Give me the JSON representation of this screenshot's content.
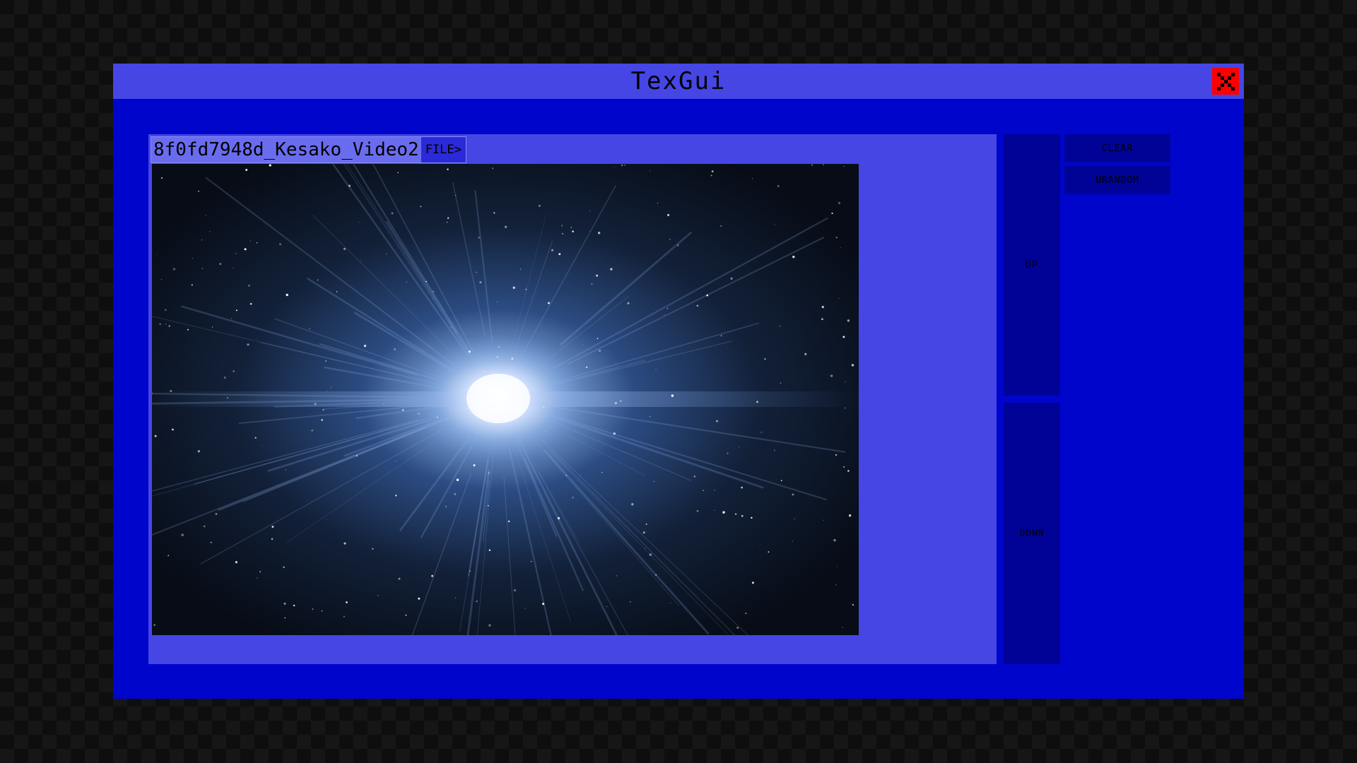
{
  "window": {
    "title": "TexGui",
    "close_icon": "close-x-icon",
    "accent_color": "#4546e4",
    "background_color": "#0005cc",
    "close_color": "#ff0000"
  },
  "viewer": {
    "filename": "8f0fd7948d_Kesako_Video2",
    "file_tag": "FILE>",
    "image_description_icon": "space-nebula-image"
  },
  "controls": {
    "up_label": "UP",
    "down_label": "DOWN",
    "clear_label": "CLEAR",
    "random_label": "URANDOM"
  }
}
